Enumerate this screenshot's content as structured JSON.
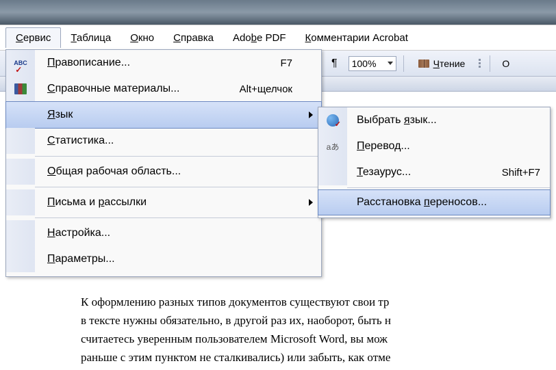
{
  "menubar": {
    "service": "ервис",
    "service_u": "С",
    "table": "аблица",
    "table_u": "Т",
    "window": "кно",
    "window_u": "О",
    "help": "правка",
    "help_u": "С",
    "adobe": "Ado",
    "adobe_u": "b",
    "adobe2": "e PDF",
    "comments": "омментарии Acrobat",
    "comments_u": "К"
  },
  "toolbar": {
    "pilcrow": "¶",
    "zoom": "100%",
    "reading": "тение",
    "reading_u": "Ч",
    "other": "О"
  },
  "menu": {
    "spelling": "равописание...",
    "spelling_u": "П",
    "spelling_key": "F7",
    "research": "правочные материалы...",
    "research_u": "С",
    "research_key": "Alt+щелчок",
    "language": "зык",
    "language_u": "Я",
    "stats": "татистика...",
    "stats_u": "С",
    "workspace": "бщая рабочая область...",
    "workspace_u": "О",
    "mail_u": "П",
    "mail": "исьма и ",
    "mail_u2": "р",
    "mail2": "ассылки",
    "customize": "астройка...",
    "customize_u": "Н",
    "options": "араметры...",
    "options_u": "П"
  },
  "submenu": {
    "setlang": "Выбрать ",
    "setlang_u": "я",
    "setlang2": "зык...",
    "translate_u": "П",
    "translate": "еревод...",
    "thesaurus_u": "Т",
    "thesaurus": "езаурус...",
    "thesaurus_key": "Shift+F7",
    "hyphen": "Расстановка ",
    "hyphen_u": "п",
    "hyphen2": "ереносов..."
  },
  "doc": {
    "l1": "К оформлению разных типов документов существуют свои тр",
    "l2": "в тексте нужны обязательно, в другой раз их, наоборот, быть н",
    "l3": "считаетесь уверенным пользователем Microsoft Word, вы мож",
    "l4": "раньше с этим пунктом не сталкивались) или забыть, как отме"
  }
}
